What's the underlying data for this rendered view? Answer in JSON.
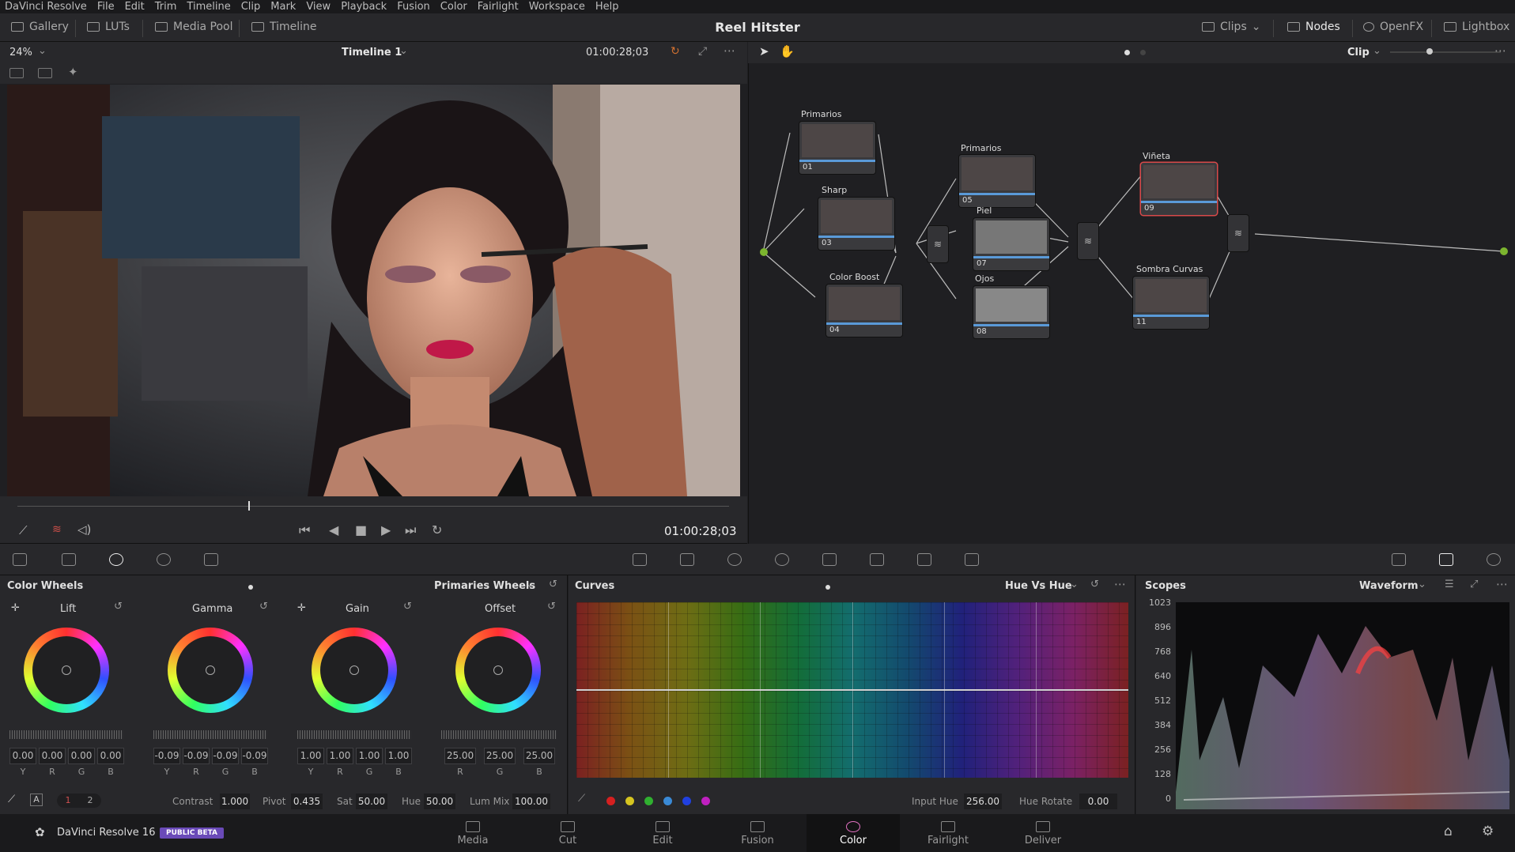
{
  "menu": [
    "DaVinci Resolve",
    "File",
    "Edit",
    "Trim",
    "Timeline",
    "Clip",
    "Mark",
    "View",
    "Playback",
    "Fusion",
    "Color",
    "Fairlight",
    "Workspace",
    "Help"
  ],
  "toolbar": {
    "gallery": "Gallery",
    "luts": "LUTs",
    "media_pool": "Media Pool",
    "timeline": "Timeline",
    "project_title": "Reel Hitster",
    "clips": "Clips",
    "nodes": "Nodes",
    "openfx": "OpenFX",
    "lightbox": "Lightbox"
  },
  "viewer": {
    "zoom": "24%",
    "timeline_name": "Timeline 1",
    "timecode_top": "01:00:28;03",
    "timecode": "01:00:28;03"
  },
  "node_editor": {
    "mode": "Clip"
  },
  "nodes": [
    {
      "label": "Primarios",
      "num": "01"
    },
    {
      "label": "Sharp",
      "num": "03"
    },
    {
      "label": "Color Boost",
      "num": "04"
    },
    {
      "label": "Primarios",
      "num": "05"
    },
    {
      "label": "Piel",
      "num": "07"
    },
    {
      "label": "Ojos",
      "num": "08"
    },
    {
      "label": "Viñeta",
      "num": "09"
    },
    {
      "label": "Sombra Curvas",
      "num": "11"
    }
  ],
  "color_wheels": {
    "title": "Color Wheels",
    "mode": "Primaries Wheels",
    "wheels": [
      {
        "name": "Lift",
        "values": [
          "0.00",
          "0.00",
          "0.00",
          "0.00"
        ],
        "channels": [
          "Y",
          "R",
          "G",
          "B"
        ]
      },
      {
        "name": "Gamma",
        "values": [
          "-0.09",
          "-0.09",
          "-0.09",
          "-0.09"
        ],
        "channels": [
          "Y",
          "R",
          "G",
          "B"
        ]
      },
      {
        "name": "Gain",
        "values": [
          "1.00",
          "1.00",
          "1.00",
          "1.00"
        ],
        "channels": [
          "Y",
          "R",
          "G",
          "B"
        ]
      },
      {
        "name": "Offset",
        "values": [
          "25.00",
          "25.00",
          "25.00"
        ],
        "channels": [
          "R",
          "G",
          "B"
        ]
      }
    ],
    "bottom": {
      "contrast_label": "Contrast",
      "contrast": "1.000",
      "pivot_label": "Pivot",
      "pivot": "0.435",
      "sat_label": "Sat",
      "sat": "50.00",
      "hue_label": "Hue",
      "hue": "50.00",
      "lummix_label": "Lum Mix",
      "lummix": "100.00",
      "page1": "1",
      "page2": "2"
    }
  },
  "curves": {
    "title": "Curves",
    "mode": "Hue Vs Hue",
    "input_hue_label": "Input Hue",
    "input_hue": "256.00",
    "hue_rotate_label": "Hue Rotate",
    "hue_rotate": "0.00",
    "swatches": [
      "#d62020",
      "#d6c520",
      "#30b030",
      "#3a8ad6",
      "#2040e0",
      "#c020c0"
    ]
  },
  "scopes": {
    "title": "Scopes",
    "mode": "Waveform",
    "ticks": [
      "1023",
      "896",
      "768",
      "640",
      "512",
      "384",
      "256",
      "128",
      "0"
    ]
  },
  "app": {
    "name": "DaVinci Resolve 16",
    "badge": "PUBLIC BETA"
  },
  "pages": [
    "Media",
    "Cut",
    "Edit",
    "Fusion",
    "Color",
    "Fairlight",
    "Deliver"
  ],
  "active_page": "Color"
}
